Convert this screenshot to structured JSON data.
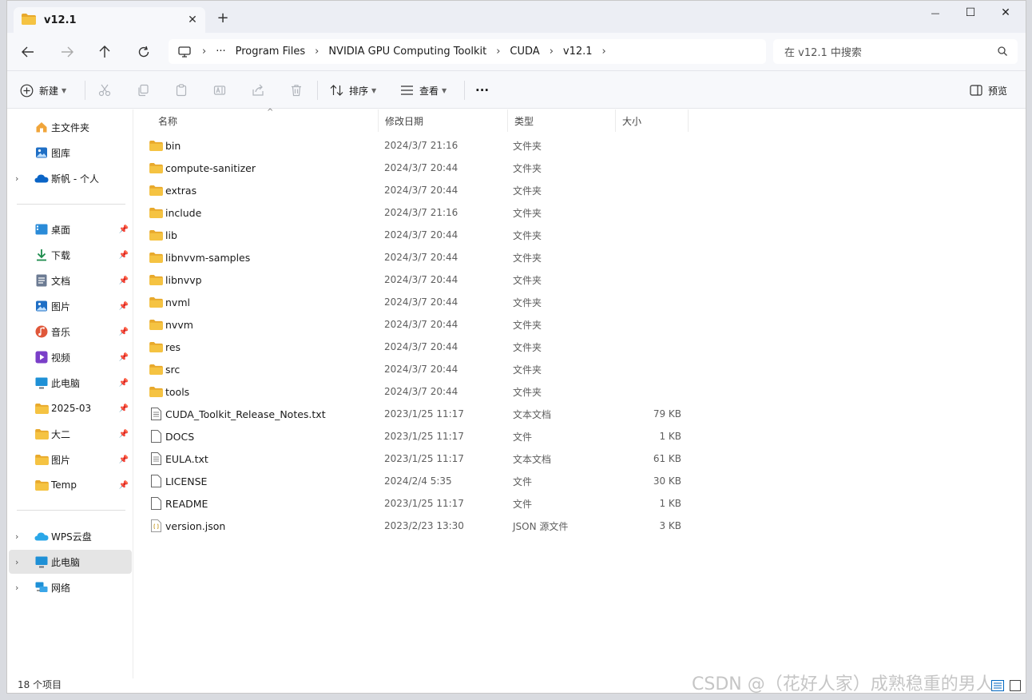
{
  "tab": {
    "title": "v12.1",
    "close": "✕",
    "new_tab": "+"
  },
  "window_controls": {
    "minimize": "—",
    "maximize": "☐",
    "close": "✕"
  },
  "address": {
    "ellipsis": "···",
    "crumbs": [
      "Program Files",
      "NVIDIA GPU Computing Toolkit",
      "CUDA",
      "v12.1"
    ]
  },
  "search": {
    "placeholder": "在 v12.1 中搜索"
  },
  "toolbar": {
    "new_label": "新建",
    "sort_label": "排序",
    "view_label": "查看",
    "more_label": "···",
    "preview_label": "预览",
    "disabled_icons": [
      "cut-icon",
      "copy-icon",
      "paste-icon",
      "rename-icon",
      "share-icon",
      "delete-icon"
    ]
  },
  "sidebar": {
    "top": [
      {
        "label": "主文件夹",
        "icon": "home-icon",
        "chevron": false
      },
      {
        "label": "图库",
        "icon": "gallery-icon",
        "chevron": false
      },
      {
        "label": "斯帆 - 个人",
        "icon": "onedrive-icon",
        "chevron": true
      }
    ],
    "quick": [
      {
        "label": "桌面",
        "icon": "desktop-icon"
      },
      {
        "label": "下载",
        "icon": "download-icon"
      },
      {
        "label": "文档",
        "icon": "document-icon"
      },
      {
        "label": "图片",
        "icon": "pictures-icon"
      },
      {
        "label": "音乐",
        "icon": "music-icon"
      },
      {
        "label": "视频",
        "icon": "video-icon"
      },
      {
        "label": "此电脑",
        "icon": "computer-icon"
      },
      {
        "label": "2025-03",
        "icon": "folder-icon"
      },
      {
        "label": "大二",
        "icon": "folder-icon"
      },
      {
        "label": "图片",
        "icon": "folder-icon"
      },
      {
        "label": "Temp",
        "icon": "folder-icon"
      }
    ],
    "bottom": [
      {
        "label": "WPS云盘",
        "icon": "wps-cloud-icon"
      },
      {
        "label": "此电脑",
        "icon": "computer-icon",
        "selected": true
      },
      {
        "label": "网络",
        "icon": "network-icon"
      }
    ]
  },
  "columns": {
    "name": "名称",
    "date": "修改日期",
    "type": "类型",
    "size": "大小"
  },
  "files": [
    {
      "name": "bin",
      "date": "2024/3/7 21:16",
      "type": "文件夹",
      "size": "",
      "kind": "folder"
    },
    {
      "name": "compute-sanitizer",
      "date": "2024/3/7 20:44",
      "type": "文件夹",
      "size": "",
      "kind": "folder"
    },
    {
      "name": "extras",
      "date": "2024/3/7 20:44",
      "type": "文件夹",
      "size": "",
      "kind": "folder"
    },
    {
      "name": "include",
      "date": "2024/3/7 21:16",
      "type": "文件夹",
      "size": "",
      "kind": "folder"
    },
    {
      "name": "lib",
      "date": "2024/3/7 20:44",
      "type": "文件夹",
      "size": "",
      "kind": "folder"
    },
    {
      "name": "libnvvm-samples",
      "date": "2024/3/7 20:44",
      "type": "文件夹",
      "size": "",
      "kind": "folder"
    },
    {
      "name": "libnvvp",
      "date": "2024/3/7 20:44",
      "type": "文件夹",
      "size": "",
      "kind": "folder"
    },
    {
      "name": "nvml",
      "date": "2024/3/7 20:44",
      "type": "文件夹",
      "size": "",
      "kind": "folder"
    },
    {
      "name": "nvvm",
      "date": "2024/3/7 20:44",
      "type": "文件夹",
      "size": "",
      "kind": "folder"
    },
    {
      "name": "res",
      "date": "2024/3/7 20:44",
      "type": "文件夹",
      "size": "",
      "kind": "folder"
    },
    {
      "name": "src",
      "date": "2024/3/7 20:44",
      "type": "文件夹",
      "size": "",
      "kind": "folder"
    },
    {
      "name": "tools",
      "date": "2024/3/7 20:44",
      "type": "文件夹",
      "size": "",
      "kind": "folder"
    },
    {
      "name": "CUDA_Toolkit_Release_Notes.txt",
      "date": "2023/1/25 11:17",
      "type": "文本文档",
      "size": "79 KB",
      "kind": "text"
    },
    {
      "name": "DOCS",
      "date": "2023/1/25 11:17",
      "type": "文件",
      "size": "1 KB",
      "kind": "file"
    },
    {
      "name": "EULA.txt",
      "date": "2023/1/25 11:17",
      "type": "文本文档",
      "size": "61 KB",
      "kind": "text"
    },
    {
      "name": "LICENSE",
      "date": "2024/2/4 5:35",
      "type": "文件",
      "size": "30 KB",
      "kind": "file"
    },
    {
      "name": "README",
      "date": "2023/1/25 11:17",
      "type": "文件",
      "size": "1 KB",
      "kind": "file"
    },
    {
      "name": "version.json",
      "date": "2023/2/23 13:30",
      "type": "JSON 源文件",
      "size": "3 KB",
      "kind": "json"
    }
  ],
  "status": {
    "count": "18 个项目"
  },
  "watermark": "CSDN @（花好人家）成熟稳重的男人",
  "colors": {
    "folder": "#f5c342",
    "folder_dark": "#e8a92c",
    "accent": "#0067c0",
    "selected_bg": "#e5e5e5"
  }
}
